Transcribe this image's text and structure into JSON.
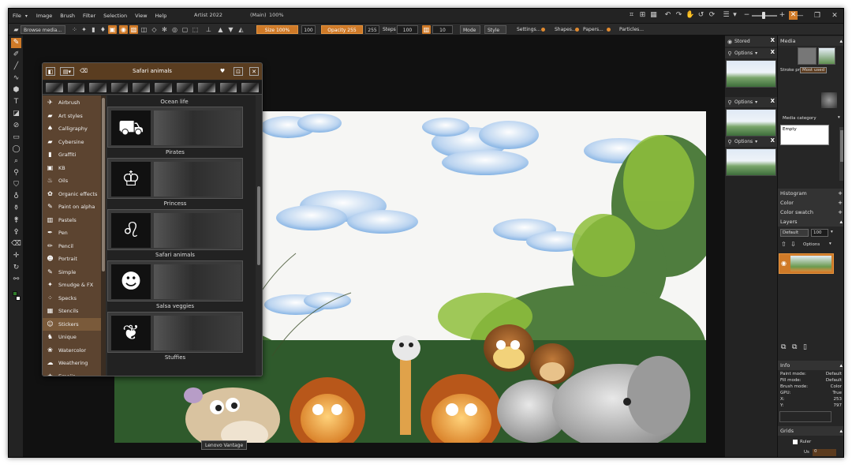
{
  "menu": {
    "items": [
      "File",
      "Image",
      "Brush",
      "Filter",
      "Selection",
      "View",
      "Help"
    ],
    "title": "Artist 2022",
    "mode": "(Main)",
    "zoom": "100%"
  },
  "toolbar": {
    "browse_media": "Browse media...",
    "size": "Size 100%",
    "size_value": "100",
    "opacity": "Opacity 255",
    "opacity_value": "255",
    "steps_label": "Steps",
    "steps_value": "100",
    "spacing_value": "10",
    "mode_label": "Mode",
    "style_label": "Style",
    "settings_label": "Settings...",
    "shapes_label": "Shapes...",
    "papers_label": "Papers...",
    "particles_label": "Particles..."
  },
  "media_panel": {
    "title": "Safari animals",
    "categories": [
      "Airbrush",
      "Art styles",
      "Calligraphy",
      "Cybersine",
      "Graffiti",
      "KB",
      "Oils",
      "Organic effects",
      "Paint on alpha",
      "Pastels",
      "Pen",
      "Pencil",
      "Portrait",
      "Simple",
      "Smudge & FX",
      "Specks",
      "Stencils",
      "Stickers",
      "Unique",
      "Watercolor",
      "Weathering",
      "Emojis"
    ],
    "selected_category": "Stickers",
    "section_label": "Ocean life",
    "presets": [
      "Pirates",
      "Princess",
      "Safari animals",
      "Salsa veggies",
      "Stuffies"
    ]
  },
  "right_left_panel": {
    "stored_label": "Stored",
    "options_label": "Options"
  },
  "right_panel": {
    "media_label": "Media",
    "stroke_prv": "Stroke prv",
    "most_used": "Most used",
    "media_category": "Media category",
    "empty": "Empty",
    "histogram": "Histogram",
    "color": "Color",
    "color_swatch": "Color swatch",
    "layers": "Layers",
    "blend_mode": "Default",
    "layer_opacity": "100",
    "options_label": "Options",
    "info_label": "Info",
    "info": [
      {
        "k": "Paint mode:",
        "v": "Default"
      },
      {
        "k": "Fill mode:",
        "v": "Default"
      },
      {
        "k": "Brush mode:",
        "v": "Color"
      },
      {
        "k": "GPU:",
        "v": "True"
      },
      {
        "k": "X:",
        "v": "253"
      },
      {
        "k": "Y:",
        "v": "797"
      }
    ],
    "grids_label": "Grids",
    "ruler_label": "Ruler",
    "us_label": "Us",
    "us_value": "0"
  },
  "tooltip": "Lenovo Vantage",
  "colors": {
    "accent": "#cf7a28",
    "panel_brown": "#5c4430",
    "header_brown": "#5a3d20"
  }
}
